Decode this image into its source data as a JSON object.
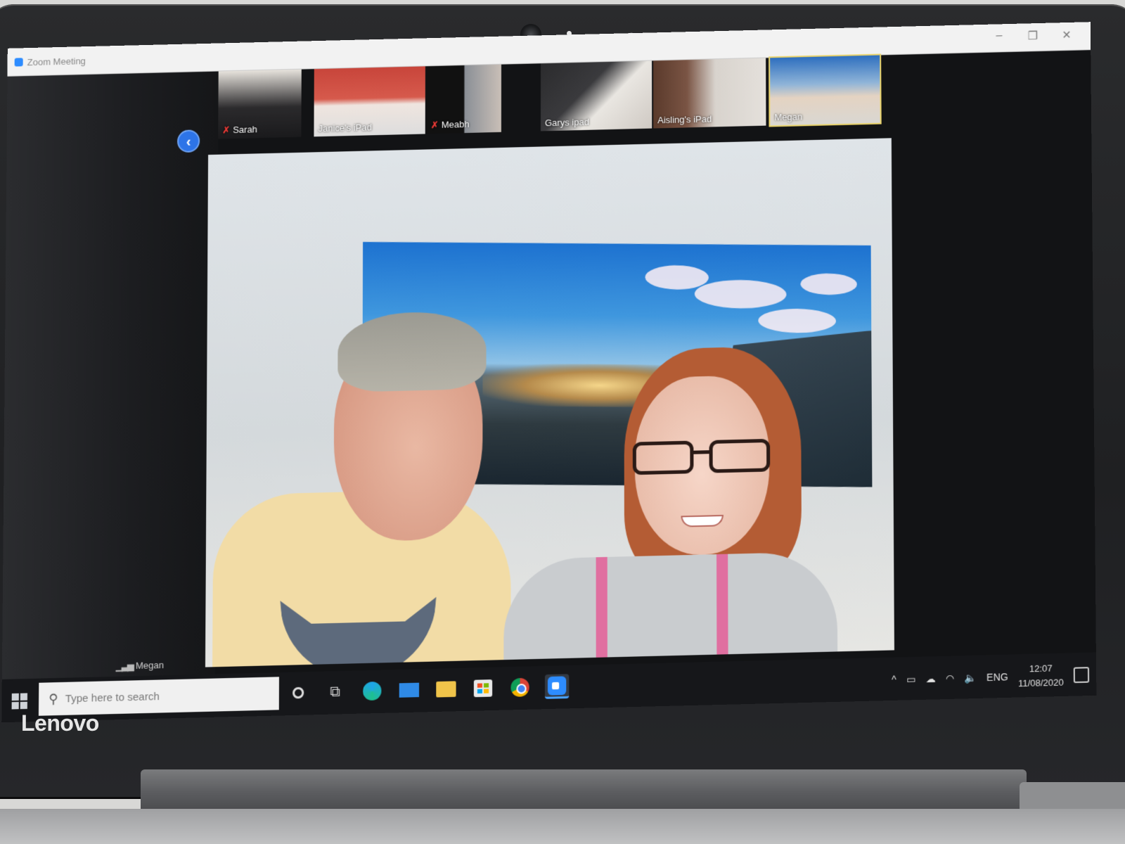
{
  "device": {
    "brand": "Lenovo"
  },
  "window": {
    "title": "Zoom Meeting",
    "controls": {
      "minimize": "–",
      "restore": "❐",
      "close": "✕"
    }
  },
  "meeting": {
    "collapse_icon": "chevron-left-icon",
    "collapse_glyph": "‹",
    "participants": [
      {
        "name": "Sarah",
        "muted": true
      },
      {
        "name": "Janice's iPad",
        "muted": false
      },
      {
        "name": "Meabh",
        "muted": true
      },
      {
        "name": "Garys ipad",
        "muted": false
      },
      {
        "name": "Aisling's iPad",
        "muted": false
      },
      {
        "name": "Megan",
        "muted": false,
        "active": true
      }
    ],
    "mute_glyph": "✗",
    "active_speaker": {
      "name": "Megan"
    }
  },
  "taskbar": {
    "search_placeholder": "Type here to search",
    "search_glyph": "⚲",
    "pinned": [
      {
        "icon": "cortana-icon"
      },
      {
        "icon": "task-view-icon",
        "glyph": "⧉"
      },
      {
        "icon": "edge-icon"
      },
      {
        "icon": "mail-icon"
      },
      {
        "icon": "file-explorer-icon"
      },
      {
        "icon": "store-icon"
      },
      {
        "icon": "chrome-icon"
      },
      {
        "icon": "zoom-icon",
        "active": true
      }
    ],
    "tray": {
      "chevron_glyph": "^",
      "battery_glyph": "▭",
      "cloud_glyph": "☁",
      "wifi_glyph": "◠",
      "volume_glyph": "🔈",
      "language": "ENG",
      "time": "12:07",
      "date": "11/08/2020"
    }
  },
  "colors": {
    "zoom_blue": "#2d8cff",
    "active_border": "#e9d36b",
    "mute_red": "#e53935"
  }
}
